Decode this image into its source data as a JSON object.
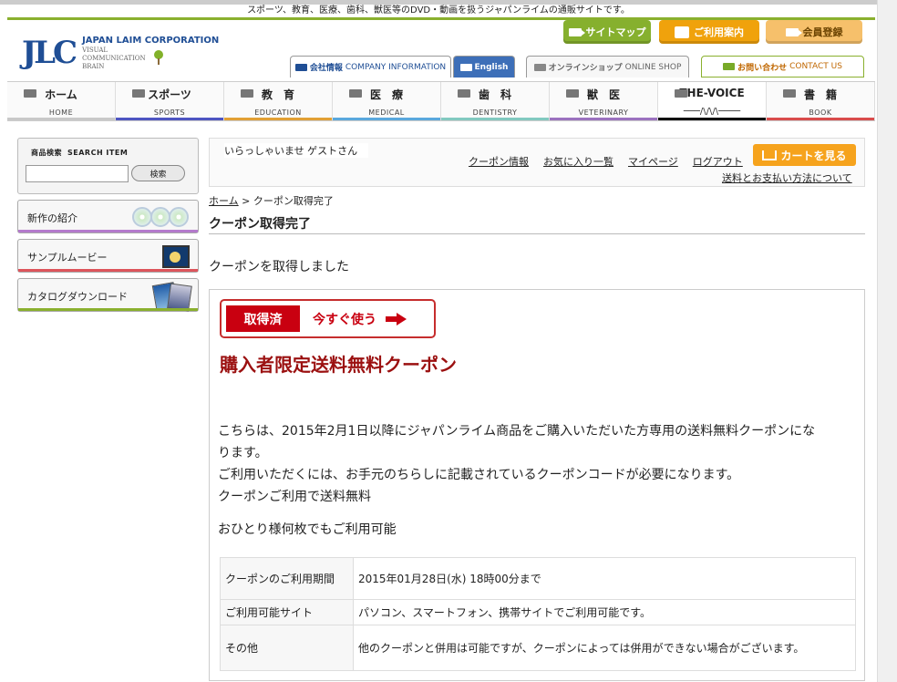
{
  "header": {
    "top_message": "スポーツ、教育、医療、歯科、獣医等のDVD・動画を扱うジャパンライムの通販サイトです。",
    "logo": {
      "mark": "JLC",
      "company": "JAPAN LAIM CORPORATION",
      "sub_lines": [
        "VISUAL",
        "COMMUNICATION",
        "BRAIN"
      ]
    },
    "buttons": {
      "sitemap": "サイトマップ",
      "guide": "ご利用案内",
      "member_register": "会員登録"
    },
    "tabs": {
      "company_jp": "会社情報",
      "company_en": "COMPANY INFORMATION",
      "english": "English",
      "shop_jp": "オンラインショップ",
      "shop_en": "ONLINE SHOP",
      "contact_jp": "お問い合わせ",
      "contact_en": "CONTACT US"
    },
    "nav": [
      {
        "jp": "ホーム",
        "en": "HOME",
        "color": "#c8c8c8"
      },
      {
        "jp": "スポーツ",
        "en": "SPORTS",
        "color": "#4e55c2"
      },
      {
        "jp": "教　育",
        "en": "EDUCATION",
        "color": "#e2a035"
      },
      {
        "jp": "医　療",
        "en": "MEDICAL",
        "color": "#5aa8dd"
      },
      {
        "jp": "歯　科",
        "en": "DENTISTRY",
        "color": "#82c9c0"
      },
      {
        "jp": "獣　医",
        "en": "VETERINARY",
        "color": "#9b72bf"
      },
      {
        "jp": "THE-VOICE",
        "en": "",
        "color": "#111111"
      },
      {
        "jp": "書　籍",
        "en": "BOOK",
        "color": "#d94c4c"
      }
    ]
  },
  "sidebar": {
    "search_title": "商品検索",
    "search_title_en": "SEARCH ITEM",
    "search_button": "検索",
    "new_intro": "新作の紹介",
    "sample_movie": "サンプルムービー",
    "catalog_download": "カタログダウンロード"
  },
  "main": {
    "welcome": "いらっしゃいませ ゲストさん",
    "links": [
      "クーポン情報",
      "お気に入り一覧",
      "マイページ",
      "ログアウト"
    ],
    "cart_button": "カートを見る",
    "shipping_link": "送料とお支払い方法について",
    "breadcrumb_home": "ホーム",
    "breadcrumb_sep": ">",
    "breadcrumb_current": "クーポン取得完了",
    "page_title": "クーポン取得完了",
    "success_message": "クーポンを取得しました",
    "coupon": {
      "acquired": "取得済",
      "use_now": "今すぐ使う",
      "title": "購入者限定送料無料クーポン",
      "description_lines": [
        "こちらは、2015年2月1日以降にジャパンライム商品をご購入いただいた方専用の送料無料クーポンにな",
        "ります。",
        "ご利用いただくには、お手元のちらしに記載されているクーポンコードが必要になります。",
        "クーポンご利用で送料無料"
      ],
      "availability": "おひとり様何枚でもご利用可能",
      "table": [
        {
          "label": "クーポンのご利用期間",
          "value": "2015年01月28日(水) 18時00分まで"
        },
        {
          "label": "ご利用可能サイト",
          "value": "パソコン、スマートフォン、携帯サイトでご利用可能です。"
        },
        {
          "label": "その他",
          "value": "他のクーポンと併用は可能ですが、クーポンによっては併用ができない場合がございます。"
        }
      ]
    }
  },
  "icons": {
    "nav": "menu-bar-icon",
    "cart": "shopping-cart-icon",
    "arrow": "arrow-right-icon"
  },
  "colors": {
    "brand_blue": "#1f4e95",
    "accent_green": "#8ab02e",
    "accent_orange": "#f6a31d",
    "coupon_red": "#c90010"
  }
}
